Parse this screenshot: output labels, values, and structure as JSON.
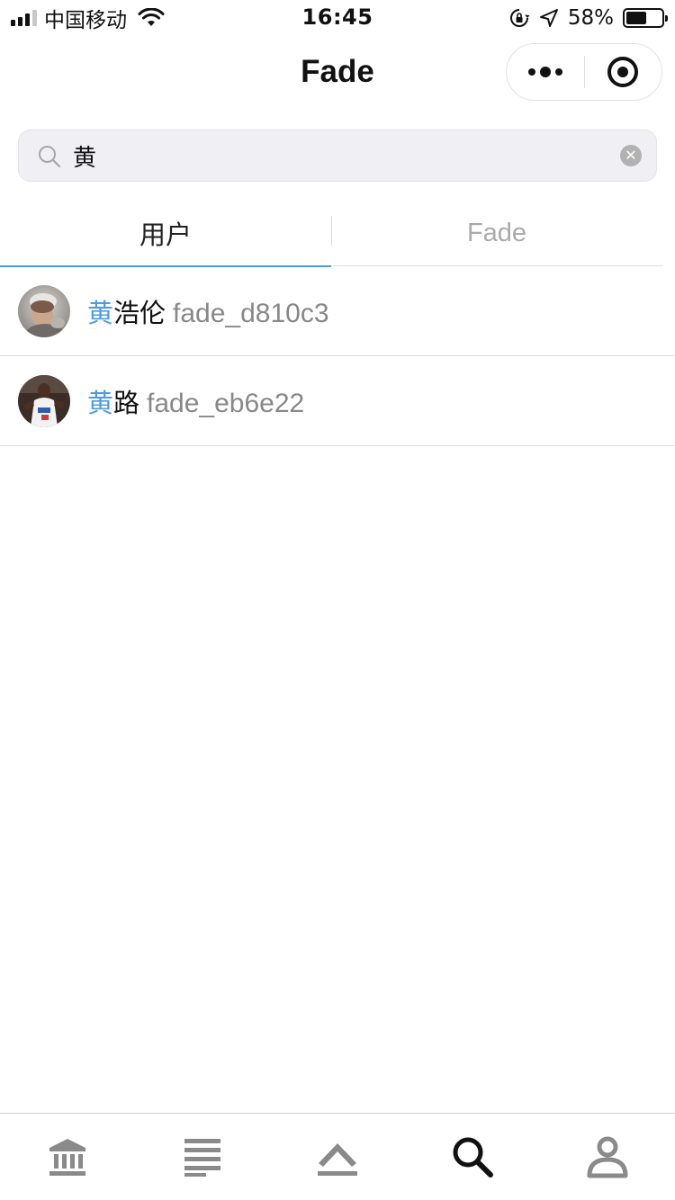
{
  "status_bar": {
    "carrier": "中国移动",
    "time": "16:45",
    "battery_percent": "58%",
    "battery_level": 0.58,
    "signal_bars_active": 3,
    "icons": [
      "signal-icon",
      "wifi-icon",
      "orientation-lock-icon",
      "location-icon",
      "battery-icon"
    ]
  },
  "nav": {
    "title": "Fade",
    "capsule": {
      "icons": [
        "more-dots-icon",
        "target-icon"
      ]
    }
  },
  "search": {
    "value": "黄",
    "placeholder": "",
    "clear_icon": "clear-icon",
    "clear_glyph": "✕"
  },
  "tabs": [
    {
      "label": "用户",
      "active": true
    },
    {
      "label": "Fade",
      "active": false
    }
  ],
  "results": [
    {
      "highlight": "黄",
      "rest": "浩伦",
      "handle": "fade_d810c3"
    },
    {
      "highlight": "黄",
      "rest": "路",
      "handle": "fade_eb6e22"
    }
  ],
  "tab_bar": {
    "items": [
      {
        "icon": "bank-icon",
        "active": false
      },
      {
        "icon": "list-icon",
        "active": false
      },
      {
        "icon": "chevron-up-icon",
        "active": false
      },
      {
        "icon": "search-icon",
        "active": true
      },
      {
        "icon": "user-icon",
        "active": false
      }
    ],
    "colors": {
      "active": "#111111",
      "inactive": "#8a8a8a"
    }
  },
  "colors": {
    "highlight": "#4a9be2",
    "tab_indicator": "#4a9be2",
    "search_bg": "#efeff4",
    "handle_text": "#888888"
  }
}
